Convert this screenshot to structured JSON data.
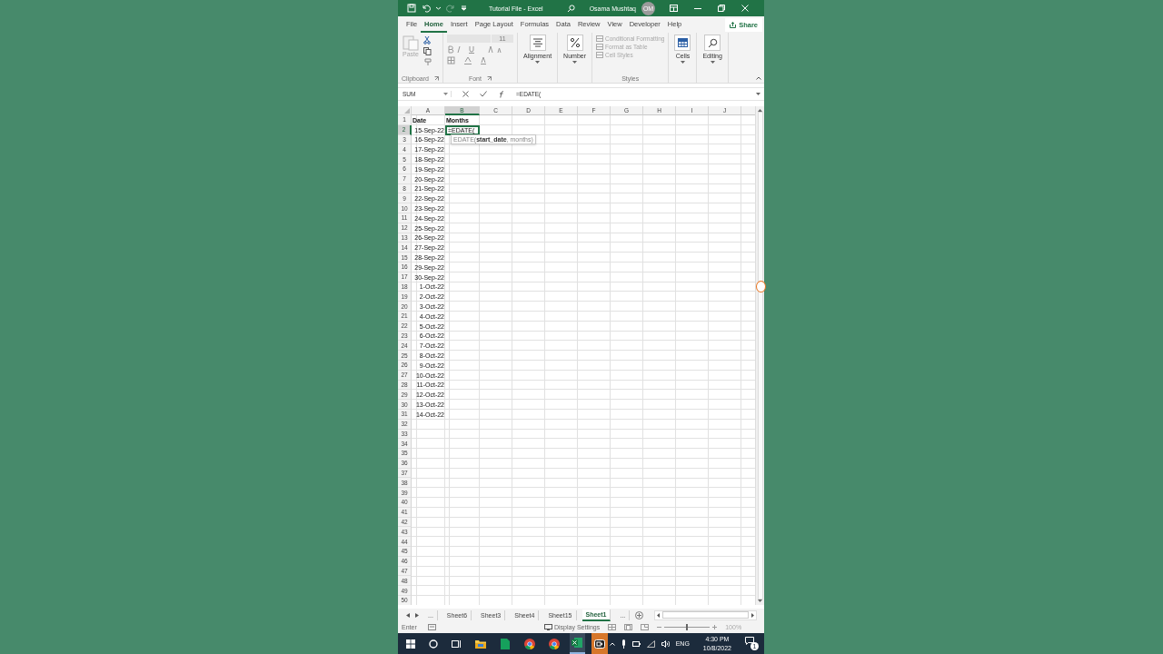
{
  "title_bar": {
    "title": "Tutorial File - Excel",
    "user": "Osama Mushtaq",
    "avatar": "OM",
    "redo_disabled": true
  },
  "tabs": [
    {
      "label": "File",
      "selected": false
    },
    {
      "label": "Home",
      "selected": true
    },
    {
      "label": "Insert",
      "selected": false
    },
    {
      "label": "Page Layout",
      "selected": false
    },
    {
      "label": "Formulas",
      "selected": false
    },
    {
      "label": "Data",
      "selected": false
    },
    {
      "label": "Review",
      "selected": false
    },
    {
      "label": "View",
      "selected": false
    },
    {
      "label": "Developer",
      "selected": false
    },
    {
      "label": "Help",
      "selected": false
    }
  ],
  "share": "Share",
  "ribbon": [
    {
      "kind": "clipboard",
      "label": "Clipboard",
      "command": "Paste",
      "disabled": true
    },
    {
      "kind": "font",
      "label": "Font",
      "font_size": "11",
      "disabled": true
    },
    {
      "kind": "alignment",
      "command": "Alignment",
      "disabled": false
    },
    {
      "kind": "number",
      "command": "Number",
      "disabled": false
    },
    {
      "kind": "styles",
      "label": "Styles",
      "commands": [
        "Conditional Formatting",
        "Format as Table",
        "Cell Styles"
      ],
      "disabled": true
    },
    {
      "kind": "cells",
      "command": "Cells",
      "disabled": false
    },
    {
      "kind": "editing",
      "command": "Editing",
      "disabled": false
    }
  ],
  "formula_bar": {
    "name_box": "SUM",
    "formula": "=EDATE("
  },
  "columns": [
    {
      "label": "A",
      "selected": false
    },
    {
      "label": "B",
      "selected": true
    },
    {
      "label": "C",
      "selected": false
    },
    {
      "label": "D",
      "selected": false
    },
    {
      "label": "E",
      "selected": false
    },
    {
      "label": "F",
      "selected": false
    },
    {
      "label": "G",
      "selected": false
    },
    {
      "label": "H",
      "selected": false
    },
    {
      "label": "I",
      "selected": false
    },
    {
      "label": "J",
      "selected": false
    }
  ],
  "rows": [
    {
      "number": "1",
      "kind": "header",
      "cells": [
        "Date",
        "Months"
      ],
      "selected": false
    },
    {
      "number": "2",
      "kind": "data",
      "cells": [
        "15-Sep-22",
        "=EDATE("
      ],
      "selected": true
    },
    {
      "number": "3",
      "kind": "data",
      "cells": [
        "16-Sep-22"
      ],
      "selected": false
    },
    {
      "number": "4",
      "kind": "data",
      "cells": [
        "17-Sep-22"
      ],
      "selected": false
    },
    {
      "number": "5",
      "kind": "data",
      "cells": [
        "18-Sep-22"
      ],
      "selected": false
    },
    {
      "number": "6",
      "kind": "data",
      "cells": [
        "19-Sep-22"
      ],
      "selected": false
    },
    {
      "number": "7",
      "kind": "data",
      "cells": [
        "20-Sep-22"
      ],
      "selected": false
    },
    {
      "number": "8",
      "kind": "data",
      "cells": [
        "21-Sep-22"
      ],
      "selected": false
    },
    {
      "number": "9",
      "kind": "data",
      "cells": [
        "22-Sep-22"
      ],
      "selected": false
    },
    {
      "number": "10",
      "kind": "data",
      "cells": [
        "23-Sep-22"
      ],
      "selected": false
    },
    {
      "number": "11",
      "kind": "data",
      "cells": [
        "24-Sep-22"
      ],
      "selected": false
    },
    {
      "number": "12",
      "kind": "data",
      "cells": [
        "25-Sep-22"
      ],
      "selected": false
    },
    {
      "number": "13",
      "kind": "data",
      "cells": [
        "26-Sep-22"
      ],
      "selected": false
    },
    {
      "number": "14",
      "kind": "data",
      "cells": [
        "27-Sep-22"
      ],
      "selected": false
    },
    {
      "number": "15",
      "kind": "data",
      "cells": [
        "28-Sep-22"
      ],
      "selected": false
    },
    {
      "number": "16",
      "kind": "data",
      "cells": [
        "29-Sep-22"
      ],
      "selected": false
    },
    {
      "number": "17",
      "kind": "data",
      "cells": [
        "30-Sep-22"
      ],
      "selected": false
    },
    {
      "number": "18",
      "kind": "data",
      "cells": [
        "1-Oct-22"
      ],
      "selected": false
    },
    {
      "number": "19",
      "kind": "data",
      "cells": [
        "2-Oct-22"
      ],
      "selected": false
    },
    {
      "number": "20",
      "kind": "data",
      "cells": [
        "3-Oct-22"
      ],
      "selected": false
    },
    {
      "number": "21",
      "kind": "data",
      "cells": [
        "4-Oct-22"
      ],
      "selected": false
    },
    {
      "number": "22",
      "kind": "data",
      "cells": [
        "5-Oct-22"
      ],
      "selected": false
    },
    {
      "number": "23",
      "kind": "data",
      "cells": [
        "6-Oct-22"
      ],
      "selected": false
    },
    {
      "number": "24",
      "kind": "data",
      "cells": [
        "7-Oct-22"
      ],
      "selected": false
    },
    {
      "number": "25",
      "kind": "data",
      "cells": [
        "8-Oct-22"
      ],
      "selected": false
    },
    {
      "number": "26",
      "kind": "data",
      "cells": [
        "9-Oct-22"
      ],
      "selected": false
    },
    {
      "number": "27",
      "kind": "data",
      "cells": [
        "10-Oct-22"
      ],
      "selected": false
    },
    {
      "number": "28",
      "kind": "data",
      "cells": [
        "11-Oct-22"
      ],
      "selected": false
    },
    {
      "number": "29",
      "kind": "data",
      "cells": [
        "12-Oct-22"
      ],
      "selected": false
    },
    {
      "number": "30",
      "kind": "data",
      "cells": [
        "13-Oct-22"
      ],
      "selected": false
    },
    {
      "number": "31",
      "kind": "data",
      "cells": [
        "14-Oct-22"
      ],
      "selected": false
    },
    {
      "number": "32",
      "selected": false
    },
    {
      "number": "33",
      "selected": false
    },
    {
      "number": "34",
      "selected": false
    },
    {
      "number": "35",
      "selected": false
    },
    {
      "number": "36",
      "selected": false
    },
    {
      "number": "37",
      "selected": false
    },
    {
      "number": "38",
      "selected": false
    },
    {
      "number": "39",
      "selected": false
    },
    {
      "number": "40",
      "selected": false
    },
    {
      "number": "41",
      "selected": false
    },
    {
      "number": "42",
      "selected": false
    },
    {
      "number": "43",
      "selected": false
    },
    {
      "number": "44",
      "selected": false
    },
    {
      "number": "45",
      "selected": false
    },
    {
      "number": "46",
      "selected": false
    },
    {
      "number": "47",
      "selected": false
    },
    {
      "number": "48",
      "selected": false
    },
    {
      "number": "49",
      "selected": false
    },
    {
      "number": "50",
      "selected": false
    }
  ],
  "tooltip": "EDATE(**start_date**, months)",
  "sheet_tabs": [
    {
      "label": "...",
      "selected": false
    },
    {
      "label": "Sheet6",
      "selected": false
    },
    {
      "label": "Sheet3",
      "selected": false
    },
    {
      "label": "Sheet4",
      "selected": false
    },
    {
      "label": "Sheet15",
      "selected": false
    },
    {
      "label": "Sheet1",
      "selected": true
    },
    {
      "label": "...",
      "selected": false
    }
  ],
  "status_bar": {
    "mode": "Enter",
    "display_settings": "Display Settings",
    "zoom": "100%",
    "level": 0.5
  },
  "taskbar": {
    "apps": [
      {
        "kind": "explorer",
        "selected": false
      },
      {
        "kind": "sheets",
        "selected": false
      },
      {
        "kind": "chrome",
        "selected": false
      },
      {
        "kind": "chrome",
        "selected": false
      },
      {
        "kind": "excel",
        "selected": true
      },
      {
        "kind": "recorder",
        "selected": false
      }
    ],
    "language": "ENG",
    "time": "4:30 PM",
    "date": "10/8/2022",
    "notifications": "1"
  }
}
